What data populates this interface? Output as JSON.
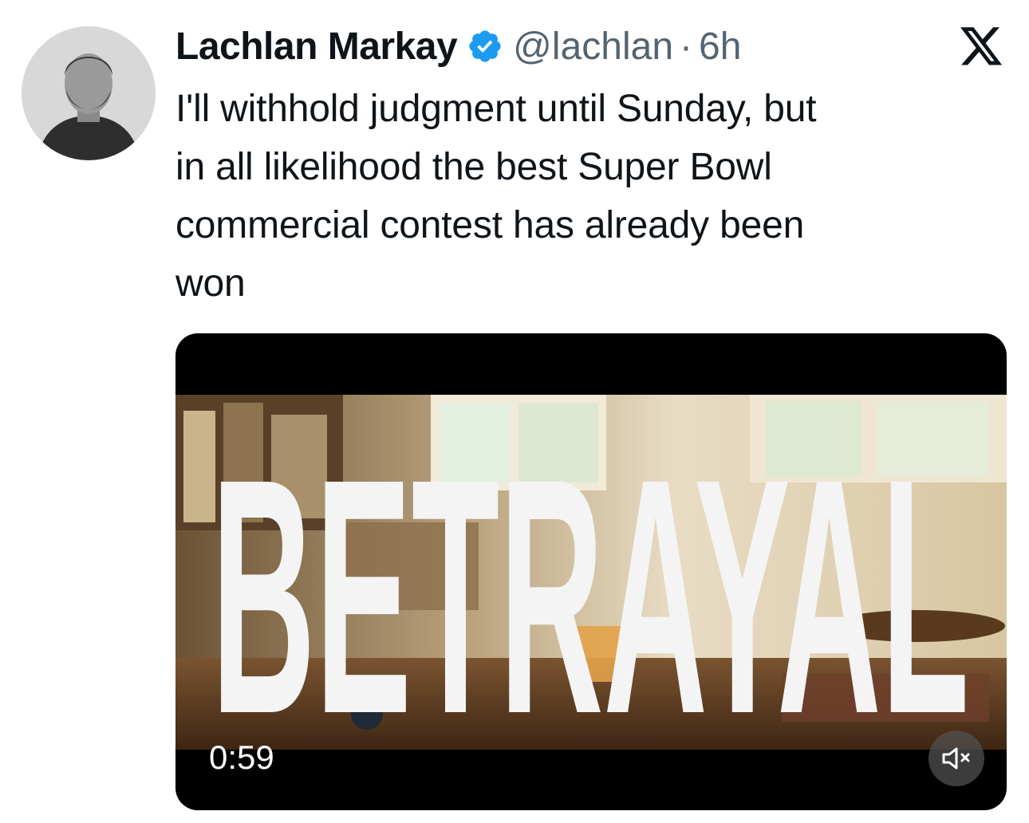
{
  "author": {
    "name": "Lachlan Markay",
    "handle": "@lachlan",
    "separator": "·",
    "time": "6h",
    "verified": true,
    "avatar_icon": "avatar-photo"
  },
  "platform_icon": "x-logo-icon",
  "tweet": {
    "lines": [
      "I'll withhold judgment until Sunday, but",
      "in all likelihood the best Super Bowl",
      "commercial contest has already been",
      "won"
    ]
  },
  "video": {
    "overlay_text": "BETRAYAL",
    "duration": "0:59",
    "mute_icon": "muted-speaker-icon"
  },
  "colors": {
    "text": "#0f1419",
    "secondary": "#536471",
    "verified": "#1d9bf0"
  }
}
